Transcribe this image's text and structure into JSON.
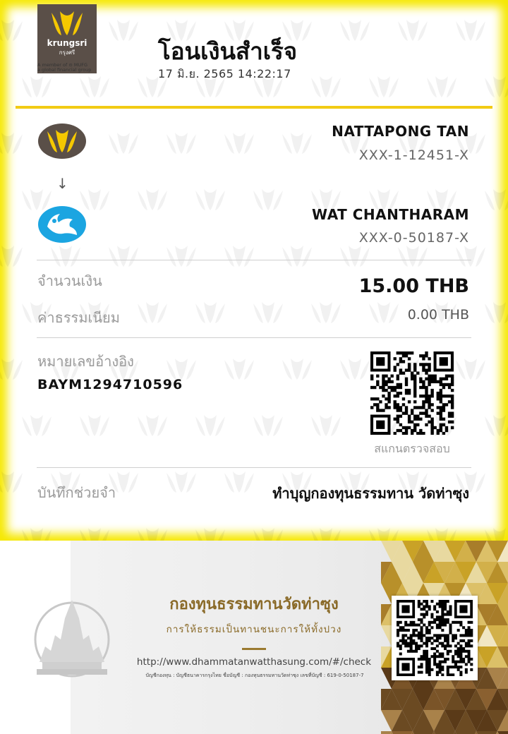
{
  "slip": {
    "bank_logo": {
      "name": "krungsri",
      "thai_name": "กรุงศรี",
      "tagline_1": "A member of ⊝ MUFG",
      "tagline_2": "a global financial group",
      "icon": "krungsri-logo-icon",
      "color": "#5a4f48"
    },
    "title": "โอนเงินสำเร็จ",
    "datetime": "17 มิ.ย. 2565 14:22:17",
    "sender": {
      "name": "NATTAPONG TAN",
      "account": "XXX-1-12451-X",
      "bank_icon": "krungsri-bank-icon"
    },
    "arrow": "↓",
    "receiver": {
      "name": "WAT CHANTHARAM",
      "account": "XXX-0-50187-X",
      "bank_icon": "ktb-bank-icon"
    },
    "amount": {
      "label": "จำนวนเงิน",
      "value": "15.00 THB"
    },
    "fee": {
      "label": "ค่าธรรมเนียม",
      "value": "0.00 THB"
    },
    "reference": {
      "label": "หมายเลขอ้างอิง",
      "value": "BAYM1294710596"
    },
    "qr": {
      "caption": "สแกนตรวจสอบ",
      "icon": "qr-code-icon"
    },
    "memo": {
      "label": "บันทึกช่วยจำ",
      "value": "ทำบุญกองทุนธรรมทาน วัดท่าซุง"
    },
    "colors": {
      "frame_yellow": "#f6e800",
      "divider_gold": "#f2cb14",
      "krungsri_brown": "#5a4f48",
      "krungsri_yellow": "#f5c800",
      "ktb_blue": "#1ba5e1"
    }
  },
  "banner": {
    "title": "กองทุนธรรมทานวัดท่าซุง",
    "subtitle": "การให้ธรรมเป็นทานชนะการให้ทั้งปวง",
    "url": "http://www.dhammatanwatthasung.com/#/check",
    "account_line": "บัญชีกองทุน : บัญชีธนาคารกรุงไทย ชื่อบัญชี : กองทุนธรรมทานวัดท่าซุง เลขที่บัญชี : 619-0-50187-7",
    "qr_icon": "qr-code-icon",
    "temple_icon": "temple-emblem-icon",
    "colors": {
      "gold_text": "#8a6a28"
    }
  }
}
